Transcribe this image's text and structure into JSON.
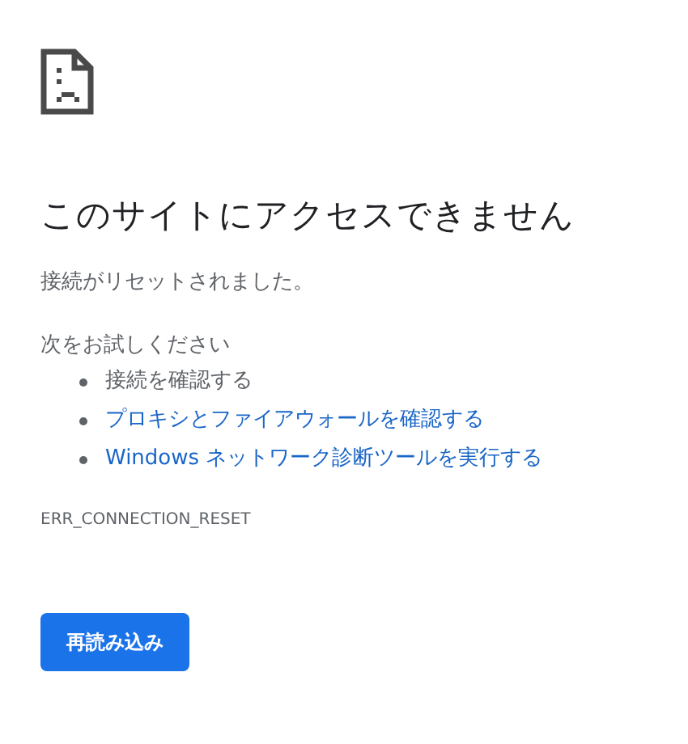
{
  "heading": "このサイトにアクセスできません",
  "message": "接続がリセットされました。",
  "suggestions_intro": "次をお試しください",
  "suggestions": [
    {
      "kind": "text",
      "text": "接続を確認する"
    },
    {
      "kind": "link",
      "text": "プロキシとファイアウォールを確認する"
    },
    {
      "kind": "link",
      "text": "Windows ネットワーク診断ツールを実行する"
    }
  ],
  "error_code": "ERR_CONNECTION_RESET",
  "buttons": [
    "再読み込み"
  ]
}
